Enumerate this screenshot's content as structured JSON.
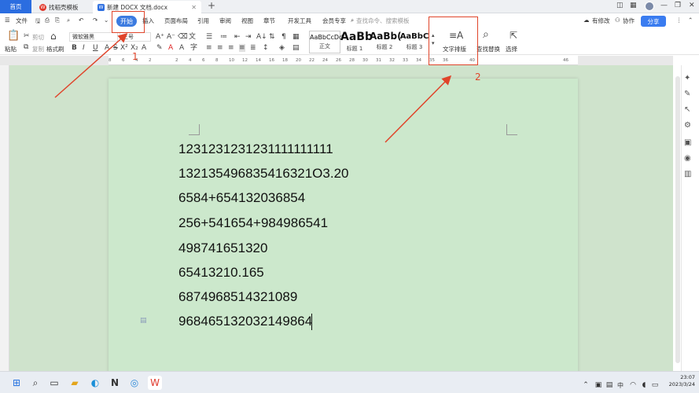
{
  "titlebar": {
    "home_tab": "首页",
    "templates_tab": "找稻壳模板",
    "doc_tab": "新建 DOCX 文档.docx",
    "add_tab": "+",
    "templates_icon": "W",
    "doc_icon": "W"
  },
  "menubar": {
    "file": "文件",
    "items": [
      "开始",
      "插入",
      "页面布局",
      "引用",
      "审阅",
      "视图",
      "章节",
      "开发工具",
      "会员专享"
    ],
    "search_placeholder": "查找命令、搜索模板",
    "modified": "有修改",
    "collab": "协作",
    "share": "分享"
  },
  "ribbon": {
    "paste": "粘贴",
    "cut": "剪切",
    "copy": "复制",
    "format_painter": "格式刷",
    "font_name": "微软雅黑",
    "font_size": "三号",
    "styles": [
      {
        "preview": "AaBbCcDd",
        "label": "正文"
      },
      {
        "preview": "AaBb",
        "label": "标题 1"
      },
      {
        "preview": "AaBb(",
        "label": "标题 2"
      },
      {
        "preview": "AaBbC",
        "label": "标题 3"
      }
    ],
    "text_layout": "文字排版",
    "find_replace": "查找替换",
    "select": "选择"
  },
  "ruler": {
    "ticks": [
      "8",
      "6",
      "4",
      "2",
      "",
      "2",
      "4",
      "6",
      "8",
      "10",
      "12",
      "14",
      "16",
      "18",
      "20",
      "22",
      "24",
      "26",
      "28",
      "30",
      "31",
      "32",
      "33",
      "34",
      "35",
      "36",
      "",
      "40",
      "",
      "",
      "",
      "",
      "",
      "",
      "46"
    ]
  },
  "document": {
    "lines": [
      "1231231231231111111111",
      "132135496835416321O3.20",
      "6584+654132036854",
      "256+541654+984986541",
      "498741651320",
      "65413210.165",
      "6874968514321089",
      "968465132032149864"
    ]
  },
  "annotations": {
    "label1": "1",
    "label2": "2",
    "color": "#e0442a"
  },
  "taskbar": {
    "time": "23:07",
    "date": "2023/3/24",
    "ime": "中"
  }
}
